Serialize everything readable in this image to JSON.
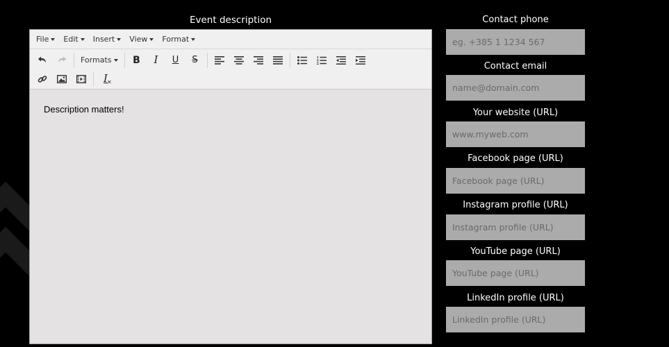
{
  "event_description": {
    "label": "Event description",
    "menubar": [
      {
        "label": "File"
      },
      {
        "label": "Edit"
      },
      {
        "label": "Insert"
      },
      {
        "label": "View"
      },
      {
        "label": "Format"
      }
    ],
    "toolbar": {
      "formats_label": "Formats",
      "bold_glyph": "B",
      "italic_glyph": "I",
      "underline_glyph": "U",
      "strike_glyph": "S",
      "clear_glyph": "I"
    },
    "content_text": "Description matters!"
  },
  "contact": {
    "phone": {
      "label": "Contact phone",
      "placeholder": "eg. +385 1 1234 567",
      "value": ""
    },
    "email": {
      "label": "Contact email",
      "placeholder": "name@domain.com",
      "value": ""
    },
    "website": {
      "label": "Your website (URL)",
      "placeholder": "www.myweb.com",
      "value": ""
    },
    "facebook": {
      "label": "Facebook page (URL)",
      "placeholder": "Facebook page (URL)",
      "value": ""
    },
    "instagram": {
      "label": "Instagram profile (URL)",
      "placeholder": "Instagram profile (URL)",
      "value": ""
    },
    "youtube": {
      "label": "YouTube page (URL)",
      "placeholder": "YouTube page (URL)",
      "value": ""
    },
    "linkedin": {
      "label": "LinkedIn profile (URL)",
      "placeholder": "LinkedIn profile (URL)",
      "value": ""
    }
  },
  "colors": {
    "background": "#000000",
    "input_background": "#ababab",
    "editor_background": "#e4e2e2",
    "toolbar_background": "#f0f0f0"
  }
}
